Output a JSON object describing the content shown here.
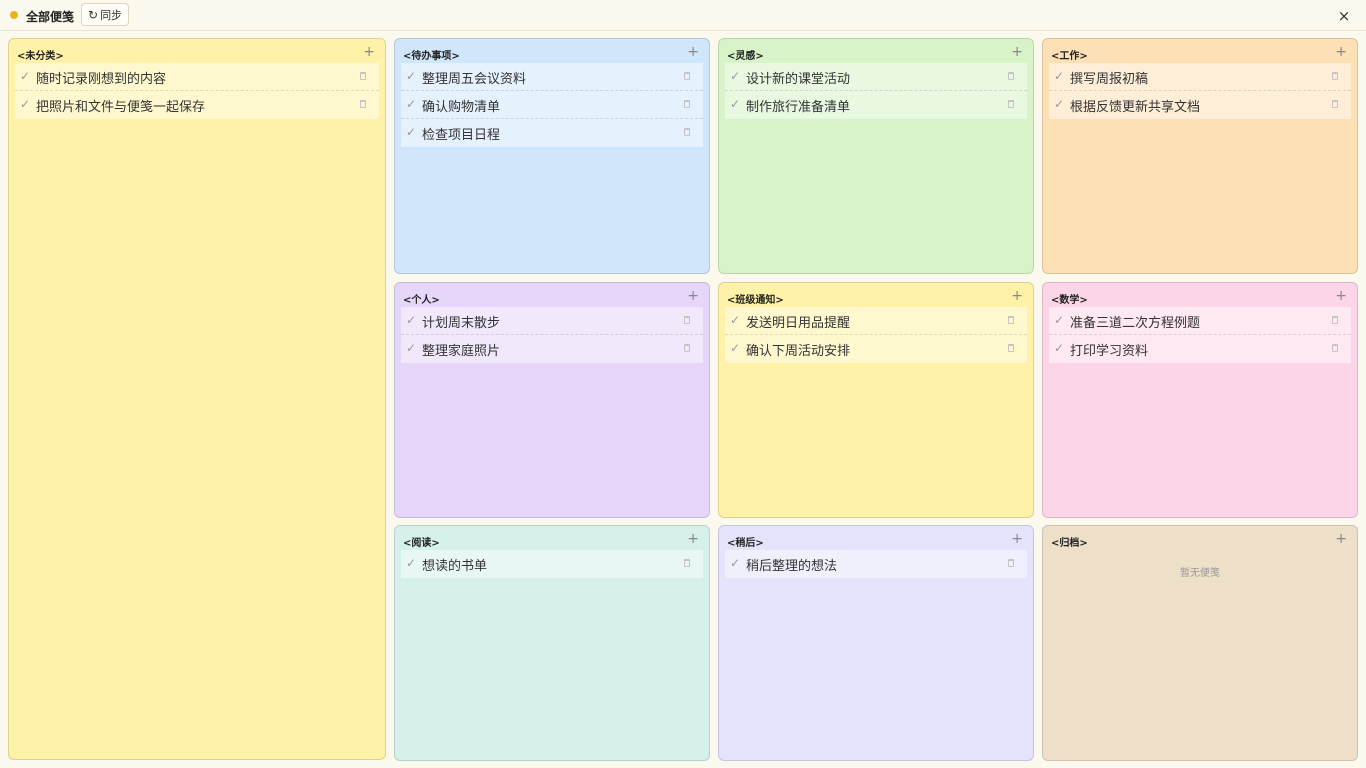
{
  "header": {
    "title": "全部便笺",
    "sync_label": "同步",
    "sync_icon": "↻",
    "close_icon": "×"
  },
  "panels": [
    {
      "key": "uncategorized",
      "title": "<未分类>",
      "color": "#fff2a8",
      "notes": [
        "随时记录刚想到的内容",
        "把照片和文件与便笺一起保存"
      ]
    },
    {
      "key": "todo",
      "title": "<待办事项>",
      "color": "#cfe6fb",
      "notes": [
        "整理周五会议资料",
        "确认购物清单",
        "检查项目日程"
      ]
    },
    {
      "key": "inspiration",
      "title": "<灵感>",
      "color": "#d8f3c8",
      "notes": [
        "设计新的课堂活动",
        "制作旅行准备清单"
      ]
    },
    {
      "key": "work",
      "title": "<工作>",
      "color": "#fde0b6",
      "notes": [
        "撰写周报初稿",
        "根据反馈更新共享文档"
      ]
    },
    {
      "key": "personal",
      "title": "<个人>",
      "color": "#e6d6fa",
      "notes": [
        "计划周末散步",
        "整理家庭照片"
      ]
    },
    {
      "key": "class",
      "title": "<班级通知>",
      "color": "#fff2a8",
      "notes": [
        "发送明日用品提醒",
        "确认下周活动安排"
      ]
    },
    {
      "key": "math",
      "title": "<数学>",
      "color": "#fdd5e8",
      "notes": [
        "准备三道二次方程例题",
        "打印学习资料"
      ]
    },
    {
      "key": "reading",
      "title": "<阅读>",
      "color": "#d6f0ec",
      "notes": [
        "想读的书单"
      ]
    },
    {
      "key": "later",
      "title": "<稍后>",
      "color": "#e3e4fc",
      "notes": [
        "稍后整理的想法"
      ]
    },
    {
      "key": "archive",
      "title": "<归档>",
      "color": "#eedfc8",
      "notes": [],
      "empty": "暂无便笺"
    }
  ]
}
